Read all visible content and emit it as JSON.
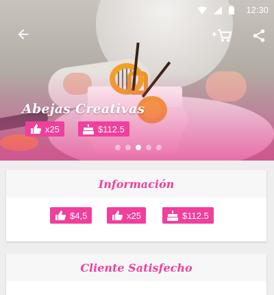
{
  "status_bar": {
    "time": "12:30"
  },
  "hero": {
    "title": "Abejas Creativas",
    "likes": "x25",
    "price": "$112.5",
    "carousel_pages": 5,
    "carousel_active": 3
  },
  "info_card": {
    "title": "Información",
    "chips": [
      {
        "icon": "like-icon",
        "value": "$4,5"
      },
      {
        "icon": "like-icon",
        "value": "x25"
      },
      {
        "icon": "cake-icon",
        "value": "$112.5"
      }
    ]
  },
  "client_card": {
    "title": "Cliente Satisfecho"
  },
  "colors": {
    "accent": "#f03f9c",
    "card_header_bg": "#f7f7f7",
    "background": "#eeeeee"
  }
}
